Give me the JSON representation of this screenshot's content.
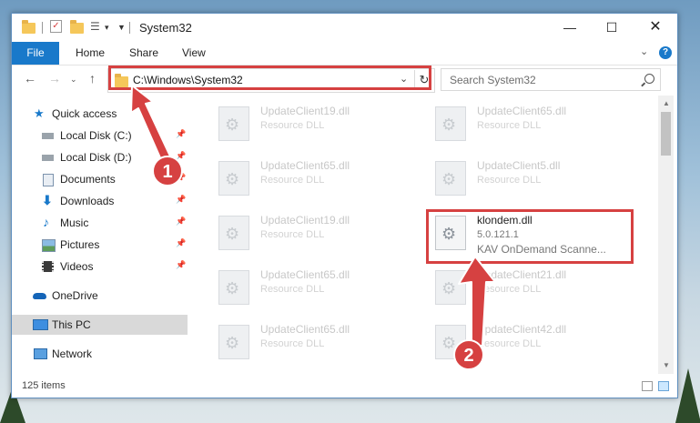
{
  "window": {
    "title": "System32",
    "item_count": "125 items"
  },
  "ribbon": {
    "tabs": [
      {
        "label": "File"
      },
      {
        "label": "Home"
      },
      {
        "label": "Share"
      },
      {
        "label": "View"
      }
    ],
    "help": "?"
  },
  "nav": {
    "address": "C:\\Windows\\System32",
    "search_placeholder": "Search System32"
  },
  "sidebar": {
    "items": [
      {
        "label": "Quick access",
        "icon": "star-icon"
      },
      {
        "label": "Local Disk (C:)",
        "icon": "drive-icon",
        "pinned": true
      },
      {
        "label": "Local Disk (D:)",
        "icon": "drive-icon",
        "pinned": true
      },
      {
        "label": "Documents",
        "icon": "documents-icon",
        "pinned": true
      },
      {
        "label": "Downloads",
        "icon": "download-icon",
        "pinned": true
      },
      {
        "label": "Music",
        "icon": "music-icon",
        "pinned": true
      },
      {
        "label": "Pictures",
        "icon": "pictures-icon",
        "pinned": true
      },
      {
        "label": "Videos",
        "icon": "videos-icon",
        "pinned": true
      },
      {
        "label": "OneDrive",
        "icon": "cloud-icon"
      },
      {
        "label": "This PC",
        "icon": "computer-icon",
        "selected": true
      },
      {
        "label": "Network",
        "icon": "network-icon"
      }
    ]
  },
  "files": [
    {
      "name": "UpdateClient19.dll",
      "desc": "Resource DLL"
    },
    {
      "name": "UpdateClient65.dll",
      "desc": "Resource DLL"
    },
    {
      "name": "UpdateClient65.dll",
      "desc": "Resource DLL"
    },
    {
      "name": "UpdateClient5.dll",
      "desc": "Resource DLL"
    },
    {
      "name": "UpdateClient19.dll",
      "desc": "Resource DLL"
    },
    {
      "name": "klondem.dll",
      "desc": "5.0.121.1",
      "desc2": "KAV OnDemand Scanne...",
      "highlighted": true
    },
    {
      "name": "UpdateClient65.dll",
      "desc": "Resource DLL"
    },
    {
      "name": "UpdateClient21.dll",
      "desc": "Resource DLL"
    },
    {
      "name": "UpdateClient65.dll",
      "desc": "Resource DLL"
    },
    {
      "name": "UpdateClient42.dll",
      "desc": "Resource DLL"
    }
  ],
  "callouts": [
    {
      "number": "1"
    },
    {
      "number": "2"
    }
  ],
  "colors": {
    "accent": "#1979ca",
    "highlight": "#d64141",
    "selection": "#cce8ff"
  }
}
